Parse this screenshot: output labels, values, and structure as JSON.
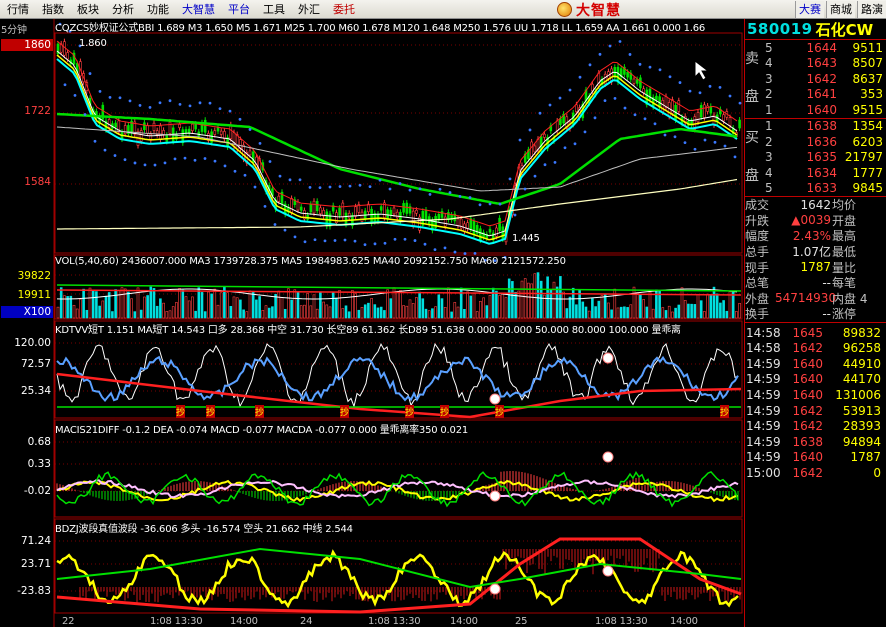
{
  "menu": {
    "left": [
      "行情",
      "指数",
      "板块",
      "分析",
      "功能",
      "大智慧",
      "平台",
      "工具",
      "外汇",
      "委托"
    ],
    "brand": "大智慧",
    "right": [
      "大赛",
      "商城",
      "路演"
    ]
  },
  "chart": {
    "period": "5分钟",
    "main_title": "CQZCS妙权证公式BBI 1.689 M3 1.650 M5 1.671 M25 1.700 M60 1.678 M120 1.648 M250 1.576 UU 1.718 LL 1.659 AA 1.661 0.000 1.66",
    "price_axis": [
      "1860",
      "1722",
      "1584"
    ],
    "price_high": "1.860",
    "price_low": "1.445",
    "vol_title": "VOL(5,40,60) 2436007.000 MA3 1739728.375 MA5 1984983.625 MA40 2092152.750 MA60 2121572.250",
    "vol_axis": [
      "39822",
      "19911",
      "X100"
    ],
    "kdj_title": "KDTVV短T 1.151 MA短T 14.543 口多 28.368 中空 31.730 长空89 61.362 长D89 51.638 0.000 20.000 50.000 80.000 100.000 量乖离",
    "kdj_axis": [
      "120.00",
      "72.57",
      "25.34"
    ],
    "macd_title": "MACIS21DIFF -0.1.2 DEA -0.074 MACD -0.077 MACDA -0.077 0.000 量乖离率350 0.021",
    "macd_axis": [
      "0.68",
      "0.33",
      "-0.02"
    ],
    "bdz_title": "BDZJ波段真值波段 -36.606 多头 -16.574 空头 21.662 中线 2.544",
    "bdz_axis": [
      "71.24",
      "23.71",
      "-23.83"
    ],
    "signal_label": "抄",
    "time_labels": [
      "22",
      "1:08 13:30",
      "14:00",
      "24",
      "1:08 13:30",
      "14:00",
      "25",
      "1:08 13:30",
      "14:00"
    ]
  },
  "stock": {
    "code": "580019",
    "name": "石化CW"
  },
  "orderbook": {
    "sell_label": "卖盘",
    "buy_label": "买盘",
    "sell": [
      {
        "lv": "5",
        "price": "1644",
        "vol": "9511"
      },
      {
        "lv": "4",
        "price": "1643",
        "vol": "8507"
      },
      {
        "lv": "3",
        "price": "1642",
        "vol": "8637"
      },
      {
        "lv": "2",
        "price": "1641",
        "vol": "353"
      },
      {
        "lv": "1",
        "price": "1640",
        "vol": "9515"
      }
    ],
    "buy": [
      {
        "lv": "1",
        "price": "1638",
        "vol": "1354"
      },
      {
        "lv": "2",
        "price": "1636",
        "vol": "6203"
      },
      {
        "lv": "3",
        "price": "1635",
        "vol": "21797"
      },
      {
        "lv": "4",
        "price": "1634",
        "vol": "1777"
      },
      {
        "lv": "5",
        "price": "1633",
        "vol": "9845"
      }
    ]
  },
  "stats": [
    {
      "k": "成交",
      "v": "1642",
      "k2": "均价",
      "style": "white"
    },
    {
      "k": "升跌",
      "v": "▲0039",
      "k2": "开盘",
      "style": "red"
    },
    {
      "k": "幅度",
      "v": "2.43%",
      "k2": "最高",
      "style": "red"
    },
    {
      "k": "总手",
      "v": "1.07亿",
      "k2": "最低",
      "style": "white"
    },
    {
      "k": "现手",
      "v": "1787",
      "k2": "量比",
      "style": "yellow"
    },
    {
      "k": "总笔",
      "v": "--",
      "k2": "每笔",
      "style": "white"
    },
    {
      "k": "外盘",
      "v": "54714930",
      "k2": "内盘 4",
      "style": "red"
    },
    {
      "k": "换手",
      "v": "--",
      "k2": "涨停",
      "style": "white"
    }
  ],
  "ticks": [
    {
      "t": "14:58",
      "p": "1645",
      "q": "89832",
      "dir": "up"
    },
    {
      "t": "14:58",
      "p": "1642",
      "q": "96258",
      "dir": "up"
    },
    {
      "t": "14:59",
      "p": "1640",
      "q": "44910",
      "dir": "up"
    },
    {
      "t": "14:59",
      "p": "1640",
      "q": "44170",
      "dir": "up"
    },
    {
      "t": "14:59",
      "p": "1640",
      "q": "131006",
      "dir": "up"
    },
    {
      "t": "14:59",
      "p": "1642",
      "q": "53913",
      "dir": "up"
    },
    {
      "t": "14:59",
      "p": "1642",
      "q": "28393",
      "dir": "up"
    },
    {
      "t": "14:59",
      "p": "1638",
      "q": "94894",
      "dir": "up"
    },
    {
      "t": "14:59",
      "p": "1640",
      "q": "1787",
      "dir": "up"
    },
    {
      "t": "15:00",
      "p": "1642",
      "q": "0",
      "dir": "up"
    }
  ]
}
